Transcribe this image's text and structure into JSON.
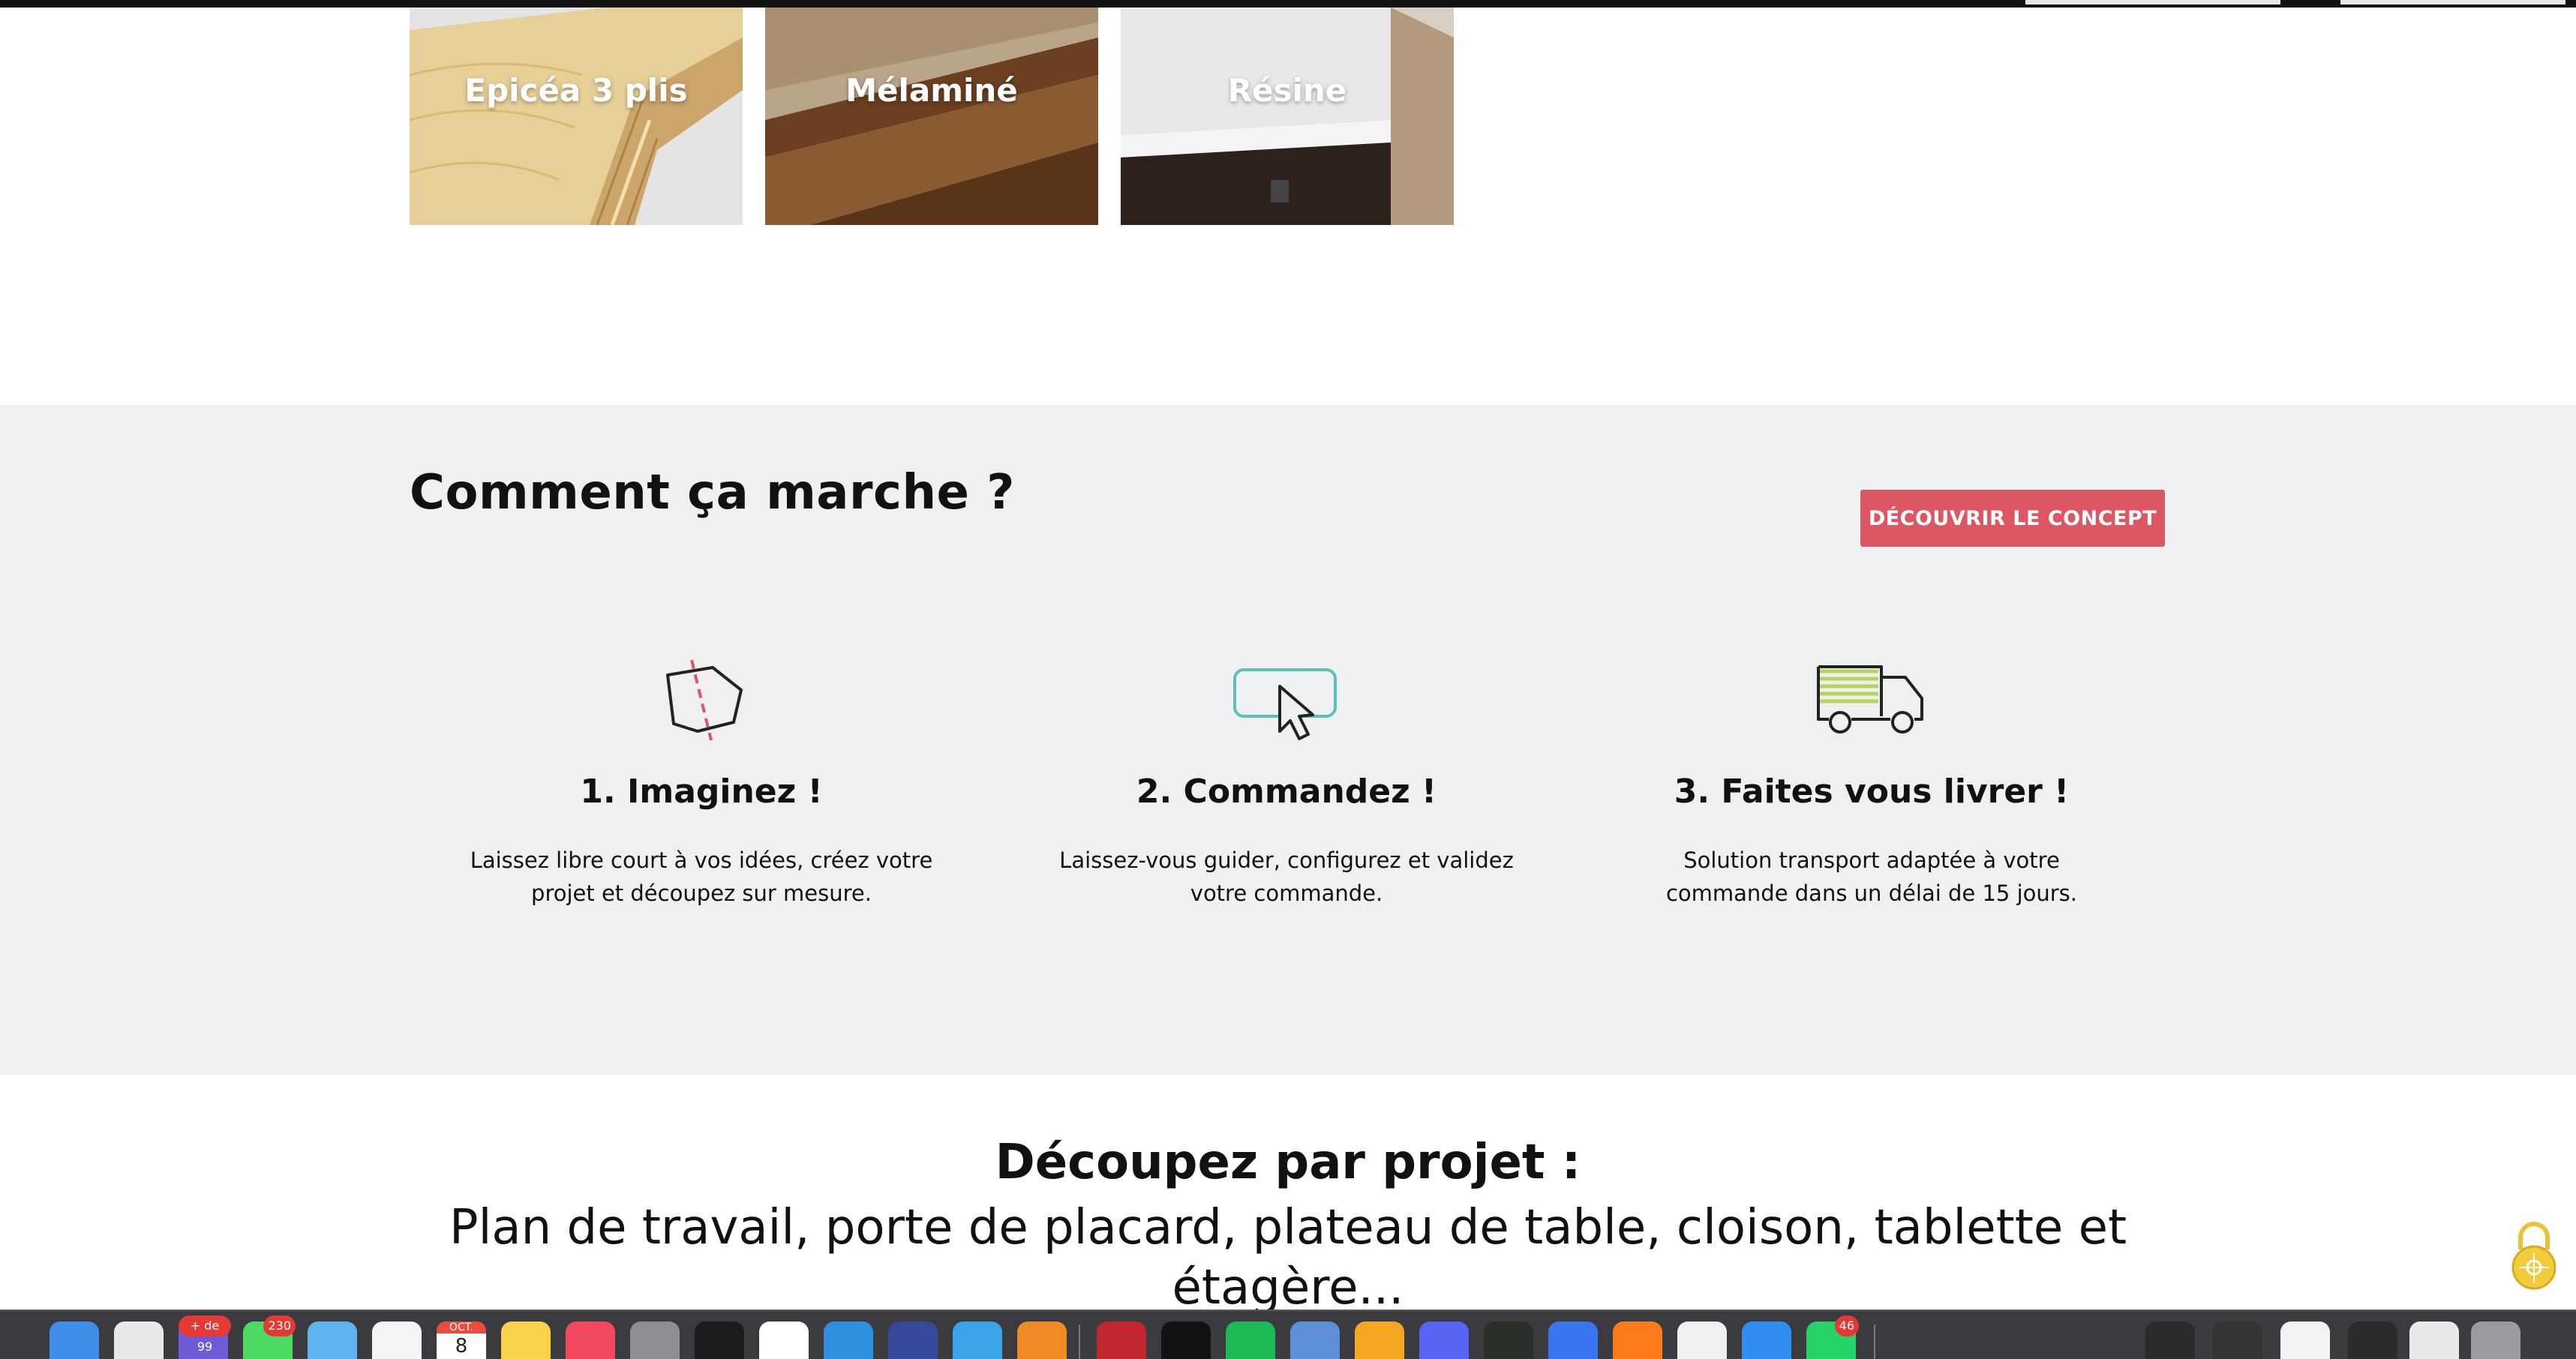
{
  "materials": {
    "tiles": [
      {
        "label": "Epicéa 3 plis"
      },
      {
        "label": "Mélaminé"
      },
      {
        "label": "Résine"
      }
    ]
  },
  "how_it_works": {
    "title": "Comment ça marche ?",
    "cta_label": "DÉCOUVRIR LE CONCEPT",
    "steps": [
      {
        "title": "1. Imaginez !",
        "text": "Laissez libre court à vos idées, créez votre projet et découpez sur mesure.",
        "icon": "cut-panel-icon"
      },
      {
        "title": "2. Commandez !",
        "text": "Laissez-vous guider, configurez et validez votre commande.",
        "icon": "click-cursor-icon"
      },
      {
        "title": "3. Faites vous livrer !",
        "text": "Solution transport adaptée à votre commande dans un délai de 15 jours.",
        "icon": "delivery-truck-icon"
      }
    ]
  },
  "projects": {
    "title": "Découpez par projet :",
    "subtitle": "Plan de travail, porte de placard, plateau de table, cloison, tablette et étagère..."
  },
  "colors": {
    "accent": "#dc5664",
    "section_bg": "#eff0f2",
    "icon_teal": "#5ec1b5",
    "icon_green": "#b5d65a",
    "icon_red": "#dc5664"
  },
  "dock": {
    "badges": {
      "mail": "+ de 99",
      "messages": "230",
      "whatsapp": "46"
    },
    "calendar": {
      "month": "OCT.",
      "day": "8"
    }
  }
}
